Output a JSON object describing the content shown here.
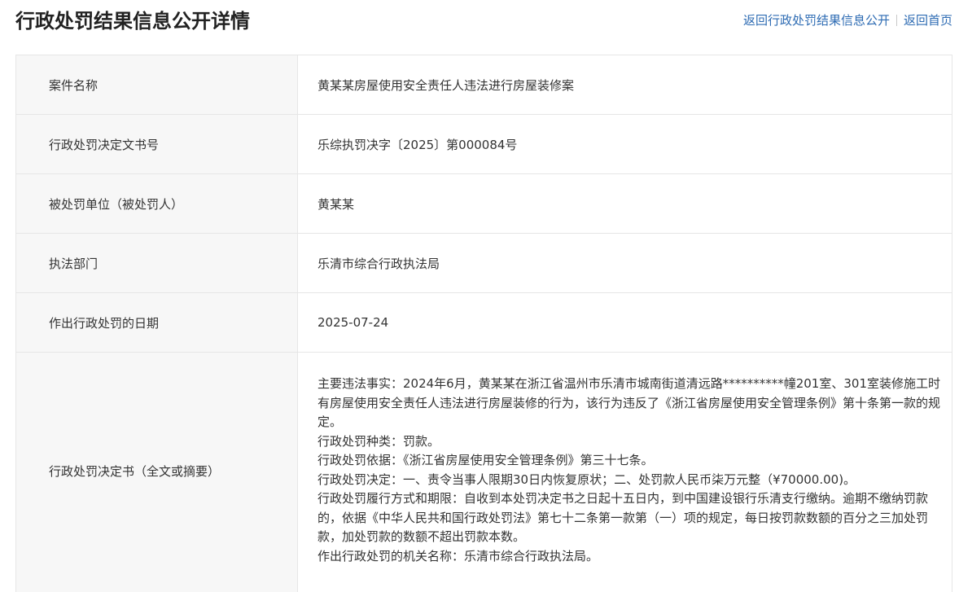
{
  "page": {
    "title": "行政处罚结果信息公开详情",
    "nav": {
      "back_to_list": "返回行政处罚结果信息公开",
      "home": "返回首页"
    }
  },
  "records": [
    {
      "label": "案件名称",
      "value": "黄某某房屋使用安全责任人违法进行房屋装修案"
    },
    {
      "label": "行政处罚决定文书号",
      "value": "乐综执罚决字〔2025〕第000084号"
    },
    {
      "label": "被处罚单位（被处罚人）",
      "value": "黄某某"
    },
    {
      "label": "执法部门",
      "value": "乐清市综合行政执法局"
    },
    {
      "label": "作出行政处罚的日期",
      "value": "2025-07-24"
    }
  ],
  "decision": {
    "label": "行政处罚决定书（全文或摘要）",
    "paragraphs": [
      "主要违法事实：2024年6月，黄某某在浙江省温州市乐清市城南街道清远路**********幢201室、301室装修施工时有房屋使用安全责任人违法进行房屋装修的行为，该行为违反了《浙江省房屋使用安全管理条例》第十条第一款的规定。",
      "行政处罚种类：罚款。",
      "行政处罚依据：《浙江省房屋使用安全管理条例》第三十七条。",
      "行政处罚决定：一、责令当事人限期30日内恢复原状；二、处罚款人民币柒万元整（¥70000.00)。",
      "行政处罚履行方式和期限：自收到本处罚决定书之日起十五日内，到中国建设银行乐清支行缴纳。逾期不缴纳罚款的，依据《中华人民共和国行政处罚法》第七十二条第一款第（一）项的规定，每日按罚款数额的百分之三加处罚款，加处罚款的数额不超出罚款本数。",
      "作出行政处罚的机关名称：乐清市综合行政执法局。"
    ]
  }
}
